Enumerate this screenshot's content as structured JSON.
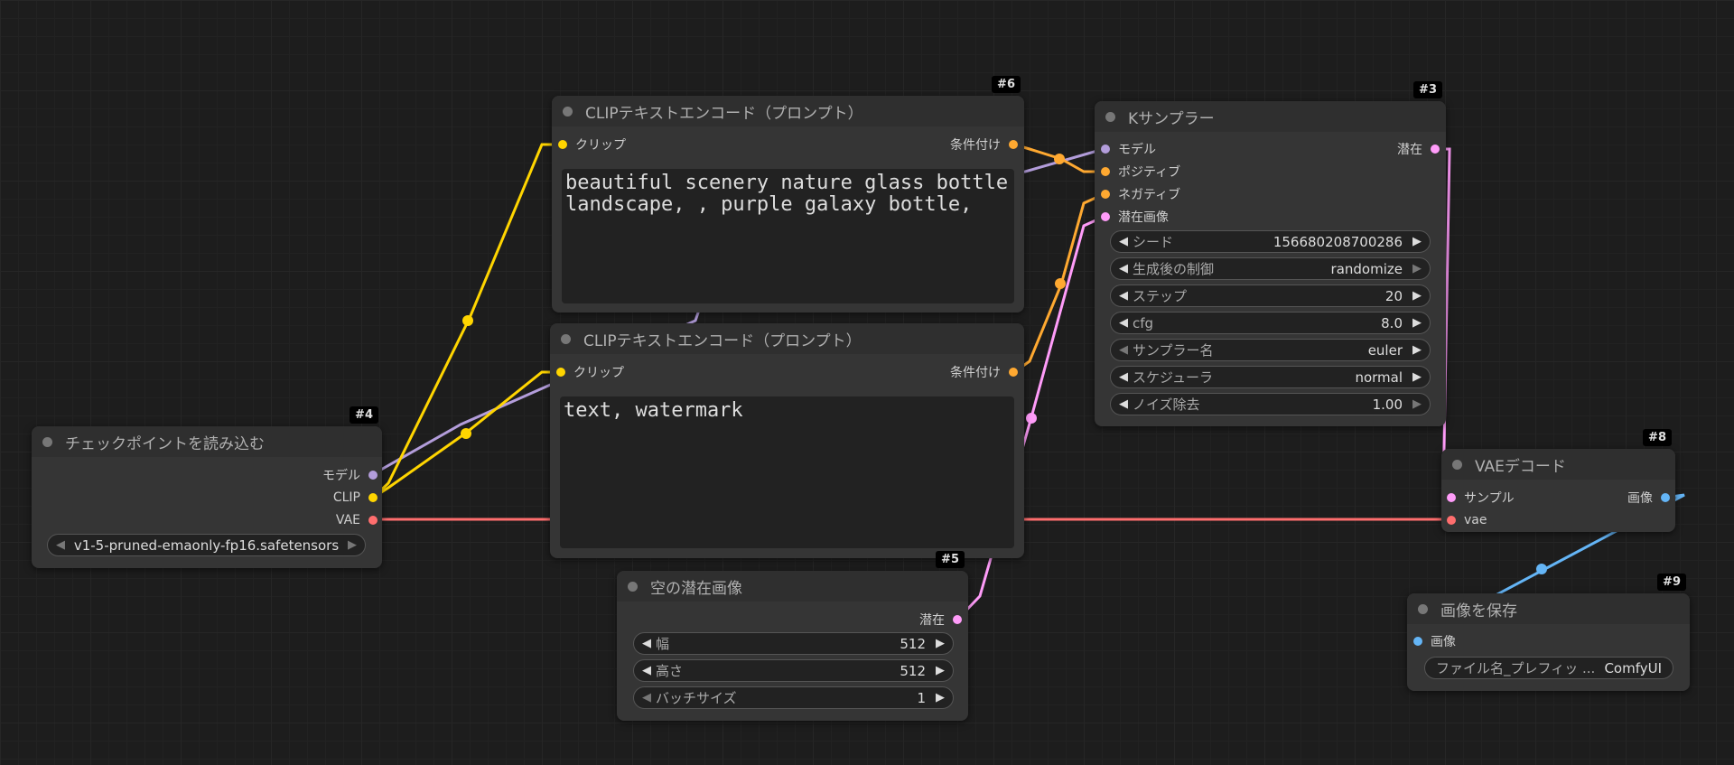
{
  "nodes": {
    "checkpoint": {
      "badge": "#4",
      "title": "チェックポイントを読み込む",
      "outputs": {
        "model": "モデル",
        "clip": "CLIP",
        "vae": "VAE"
      },
      "ckpt_name": "v1-5-pruned-emaonly-fp16.safetensors"
    },
    "clip_pos": {
      "badge": "#6",
      "title": "CLIPテキストエンコード（プロンプト）",
      "input": "クリップ",
      "output": "条件付け",
      "text": "beautiful scenery nature glass bottle\nlandscape, , purple galaxy bottle,"
    },
    "clip_neg": {
      "title": "CLIPテキストエンコード（プロンプト）",
      "input": "クリップ",
      "output": "条件付け",
      "text": "text, watermark"
    },
    "empty_latent": {
      "badge": "#5",
      "title": "空の潜在画像",
      "output": "潜在",
      "widgets": [
        {
          "label": "幅",
          "value": "512"
        },
        {
          "label": "高さ",
          "value": "512"
        },
        {
          "label": "バッチサイズ",
          "value": "1"
        }
      ]
    },
    "ksampler": {
      "badge": "#3",
      "title": "Kサンプラー",
      "inputs": [
        "モデル",
        "ポジティブ",
        "ネガティブ",
        "潜在画像"
      ],
      "output": "潜在",
      "widgets": [
        {
          "label": "シード",
          "value": "156680208700286"
        },
        {
          "label": "生成後の制御",
          "value": "randomize"
        },
        {
          "label": "ステップ",
          "value": "20"
        },
        {
          "label": "cfg",
          "value": "8.0"
        },
        {
          "label": "サンプラー名",
          "value": "euler"
        },
        {
          "label": "スケジューラ",
          "value": "normal"
        },
        {
          "label": "ノイズ除去",
          "value": "1.00"
        }
      ]
    },
    "vae_decode": {
      "badge": "#8",
      "title": "VAEデコード",
      "inputs": [
        "サンプル",
        "vae"
      ],
      "output": "画像"
    },
    "save_image": {
      "badge": "#9",
      "title": "画像を保存",
      "input": "画像",
      "prefix_label": "ファイル名_プレフィッ ...",
      "prefix_value": "ComfyUI"
    }
  },
  "colors": {
    "model": "#b39ddb",
    "clip": "#ffd500",
    "vae": "#ff6e6e",
    "conditioning": "#ffa931",
    "latent": "#ff9cf9",
    "image": "#64b5f6"
  }
}
